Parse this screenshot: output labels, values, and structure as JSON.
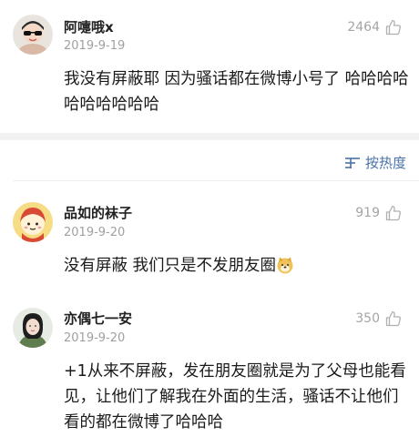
{
  "comments": [
    {
      "username": "阿嚏哦x",
      "time": "2019-9-19",
      "likes": "2464",
      "text": "我没有屏蔽耶 因为骚话都在微博小号了 哈哈哈哈哈哈哈哈哈哈"
    },
    {
      "username": "品如的袜子",
      "time": "2019-9-20",
      "likes": "919",
      "text": "没有屏蔽  我们只是不发朋友圈"
    },
    {
      "username": "亦偶七一安",
      "time": "2019-9-20",
      "likes": "350",
      "text": "+1从来不屏蔽，发在朋友圈就是为了父母也能看见，让他们了解我在外面的生活，骚话不让他们看的都在微博了哈哈哈"
    }
  ],
  "sort": {
    "label": "按热度",
    "icon": "sort-icon"
  },
  "icons": {
    "like": "thumbs-up-icon",
    "emoji": "doge-emoji-icon"
  },
  "colors": {
    "link": "#4a72a8",
    "meta": "#a0a0a0",
    "divider": "#f2f2f2"
  }
}
